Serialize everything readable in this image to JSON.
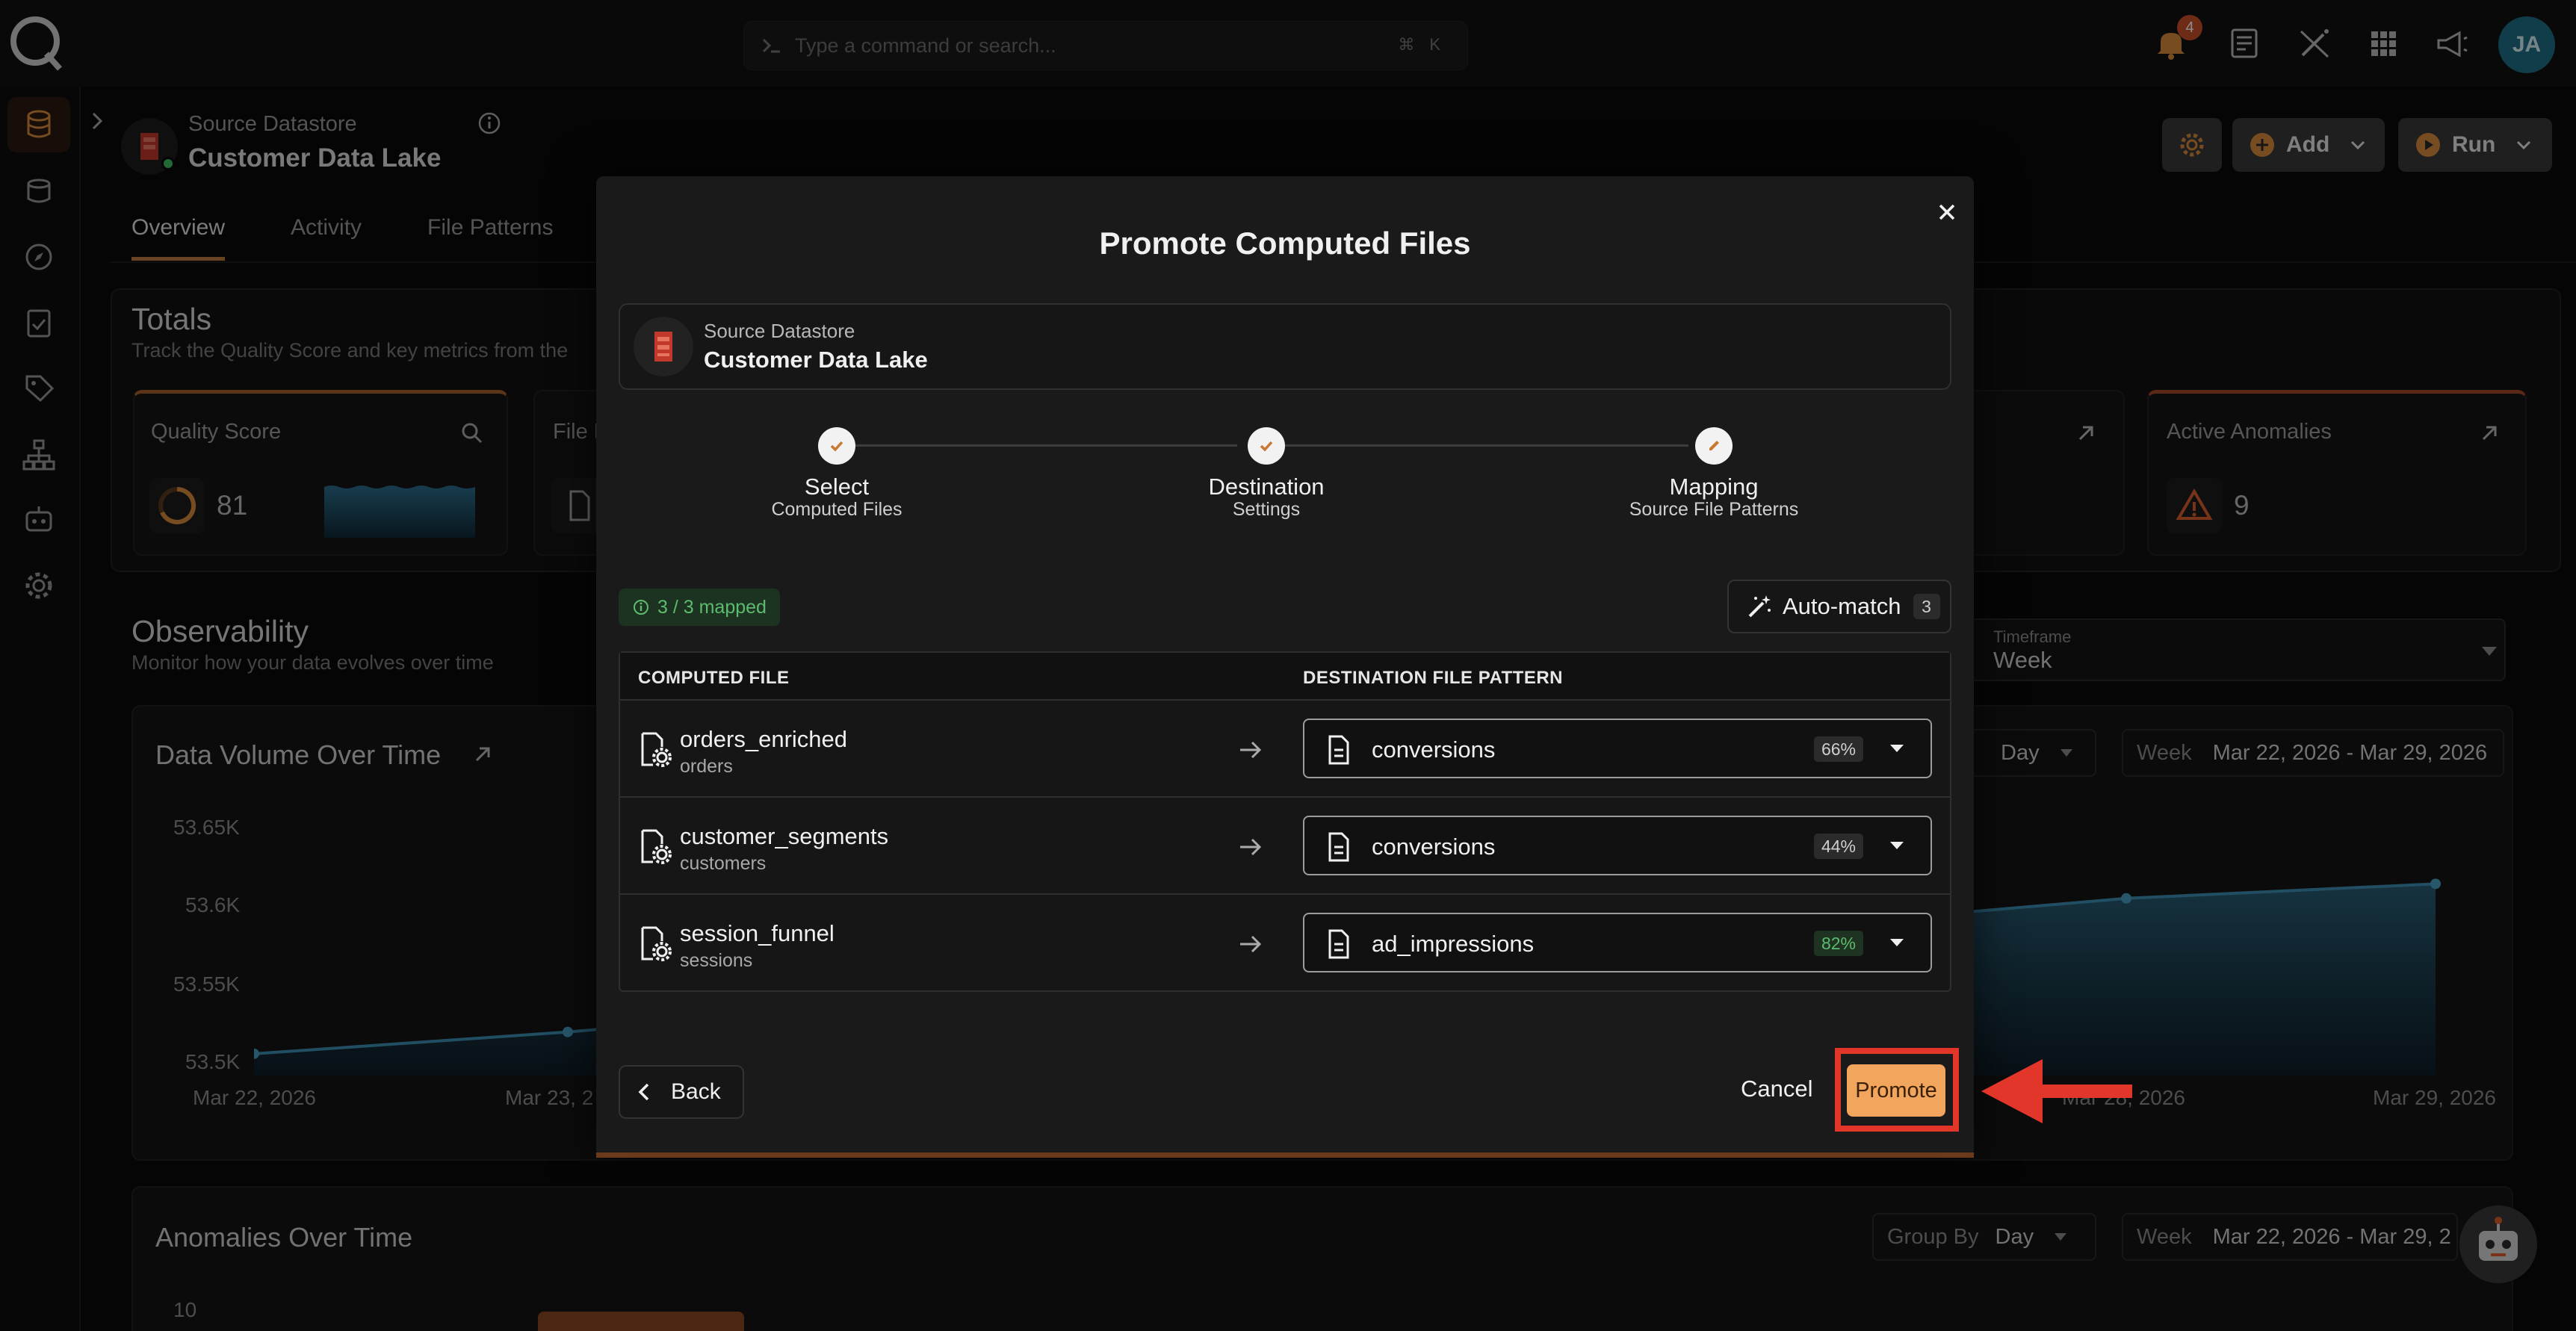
{
  "topbar": {
    "search_placeholder": "Type a command or search...",
    "shortcut_keys": [
      "⌘",
      "K"
    ],
    "notification_count": "4",
    "avatar_initials": "JA"
  },
  "header": {
    "datastore_kind": "Source Datastore",
    "datastore_name": "Customer Data Lake",
    "add_label": "Add",
    "run_label": "Run"
  },
  "tabs": [
    "Overview",
    "Activity",
    "File Patterns"
  ],
  "totals": {
    "title": "Totals",
    "subtitle": "Track the Quality Score and key metrics from the",
    "quality_score_label": "Quality Score",
    "quality_score_value": "81",
    "file_label_partial": "File P",
    "active_anomalies_label": "Active Anomalies",
    "active_anomalies_value": "9"
  },
  "observability": {
    "title": "Observability",
    "subtitle": "Monitor how your data evolves over time",
    "timeframe_label": "Timeframe",
    "timeframe_value": "Week"
  },
  "data_volume": {
    "title": "Data Volume Over Time",
    "group_value": "Day",
    "range_label": "Week",
    "range_value": "Mar 22, 2026 - Mar 29, 2026",
    "y_ticks": [
      "53.65K",
      "53.6K",
      "53.55K",
      "53.5K"
    ],
    "x_ticks": [
      "Mar 22, 2026",
      "Mar 23, 2",
      "Mar 28, 2026",
      "Mar 29, 2026"
    ]
  },
  "chart_data": {
    "type": "area",
    "title": "Data Volume Over Time",
    "x": [
      "Mar 22, 2026",
      "Mar 23, 2026",
      "Mar 28, 2026",
      "Mar 29, 2026"
    ],
    "series": [
      {
        "values": [
          53505,
          53520,
          53612,
          53622
        ]
      }
    ],
    "ylim": [
      53490,
      53670
    ]
  },
  "anomalies": {
    "title": "Anomalies Over Time",
    "group_by_label": "Group By",
    "group_by_value": "Day",
    "range_label": "Week",
    "range_value": "Mar 22, 2026 - Mar 29, 2",
    "y_tick": "10"
  },
  "modal": {
    "title": "Promote Computed Files",
    "source_kind": "Source Datastore",
    "source_name": "Customer Data Lake",
    "steps": [
      {
        "title": "Select",
        "sub": "Computed Files"
      },
      {
        "title": "Destination",
        "sub": "Settings"
      },
      {
        "title": "Mapping",
        "sub": "Source File Patterns"
      }
    ],
    "mapped_label": "3 / 3 mapped",
    "automatch_label": "Auto-match",
    "automatch_count": "3",
    "col_computed": "COMPUTED FILE",
    "col_destination": "DESTINATION FILE PATTERN",
    "rows": [
      {
        "name": "orders_enriched",
        "sub": "orders",
        "dest": "conversions",
        "pct": "66%"
      },
      {
        "name": "customer_segments",
        "sub": "customers",
        "dest": "conversions",
        "pct": "44%"
      },
      {
        "name": "session_funnel",
        "sub": "sessions",
        "dest": "ad_impressions",
        "pct": "82%"
      }
    ],
    "back_label": "Back",
    "cancel_label": "Cancel",
    "promote_label": "Promote"
  },
  "colors": {
    "accent": "#c27a3e",
    "promote": "#f2a55c",
    "highlight": "#e2362a",
    "success": "#5dbb6e",
    "pct_mid": "#cfcfcf",
    "pct_high": "#5dbb6e"
  }
}
